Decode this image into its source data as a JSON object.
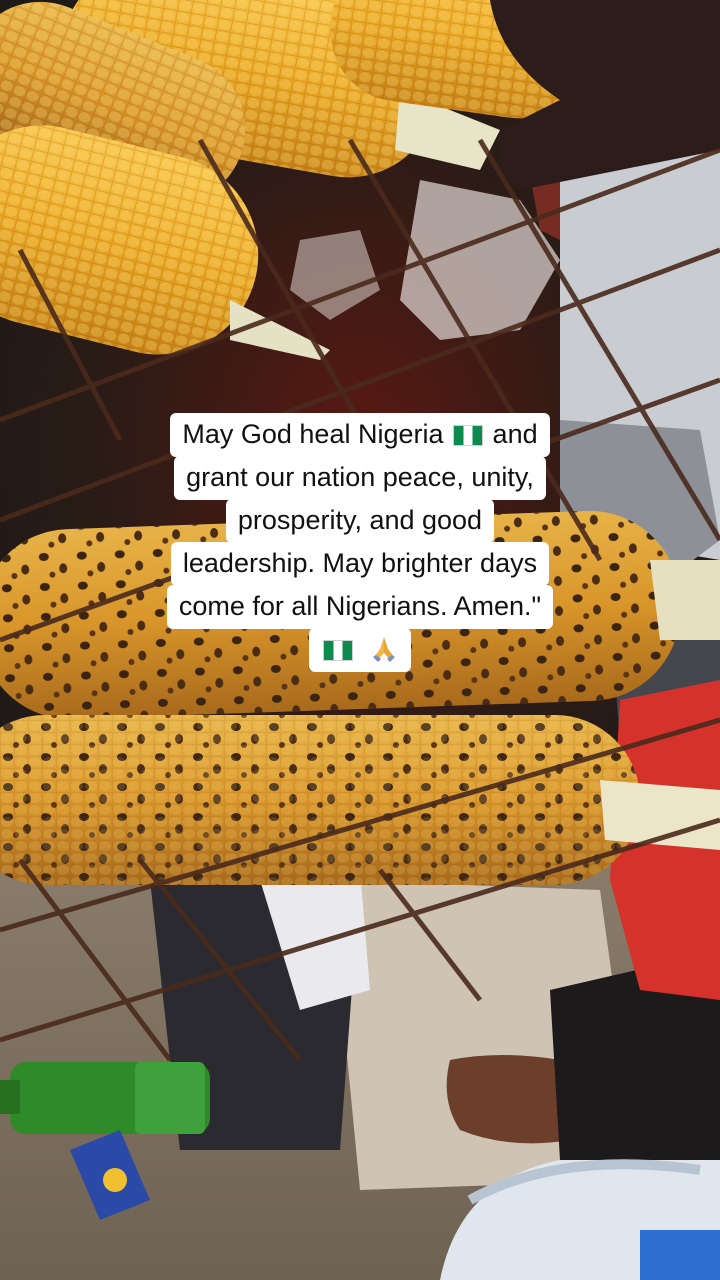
{
  "caption": {
    "line1_a": "May God heal Nigeria",
    "line1_b": "and",
    "line2": "grant our nation peace, unity,",
    "line3": "prosperity, and good",
    "line4": "leadership. May brighter days",
    "line5": "come for all Nigerians. Amen.\""
  },
  "icons": {
    "flag": "nigeria-flag-icon",
    "hands": "folded-hands-icon"
  },
  "colors": {
    "caption_bg": "#ffffff",
    "caption_text": "#111111",
    "corn": "#e6a72a",
    "char_marks": "#3b2412",
    "grill_wire": "#4a2a1c"
  }
}
